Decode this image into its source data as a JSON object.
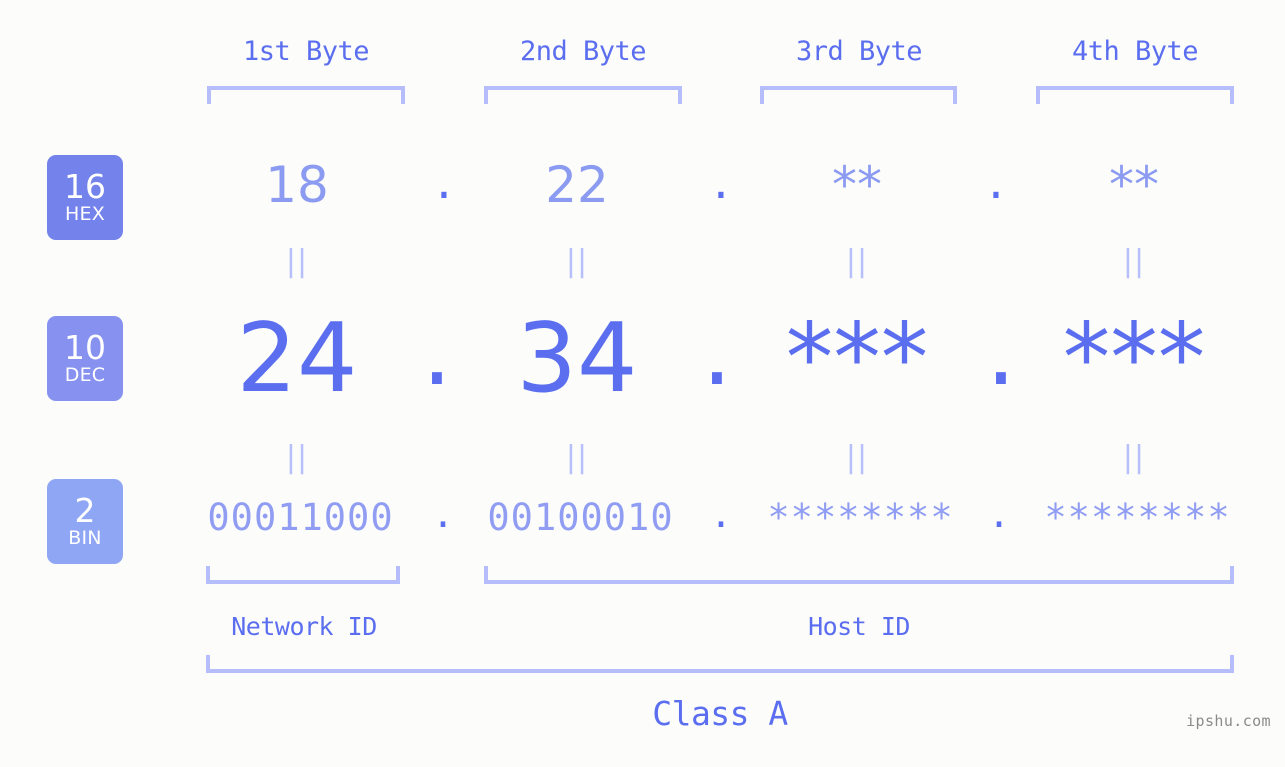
{
  "background_color": "#fcfdfa",
  "accent_color": "#5b6ef0",
  "accent_light": "#8c9bf2",
  "bracket_color": "#b5bdfb",
  "headers": [
    {
      "label": "1st Byte"
    },
    {
      "label": "2nd Byte"
    },
    {
      "label": "3rd Byte"
    },
    {
      "label": "4th Byte"
    }
  ],
  "bases": [
    {
      "num": "16",
      "name": "HEX",
      "color": "#7482ec"
    },
    {
      "num": "10",
      "name": "DEC",
      "color": "#8792f0"
    },
    {
      "num": "2",
      "name": "BIN",
      "color": "#8fa6f5"
    }
  ],
  "rows": {
    "hex": {
      "b1": "18",
      "b2": "22",
      "b3": "**",
      "b4": "**"
    },
    "dec": {
      "b1": "24",
      "b2": "34",
      "b3": "***",
      "b4": "***"
    },
    "bin": {
      "b1": "00011000",
      "b2": "00100010",
      "b3": "********",
      "b4": "********"
    }
  },
  "separators": {
    "dot": ".",
    "equals": "||"
  },
  "sections": {
    "network_id": "Network ID",
    "host_id": "Host ID",
    "class": "Class A"
  },
  "watermark": "ipshu.com"
}
